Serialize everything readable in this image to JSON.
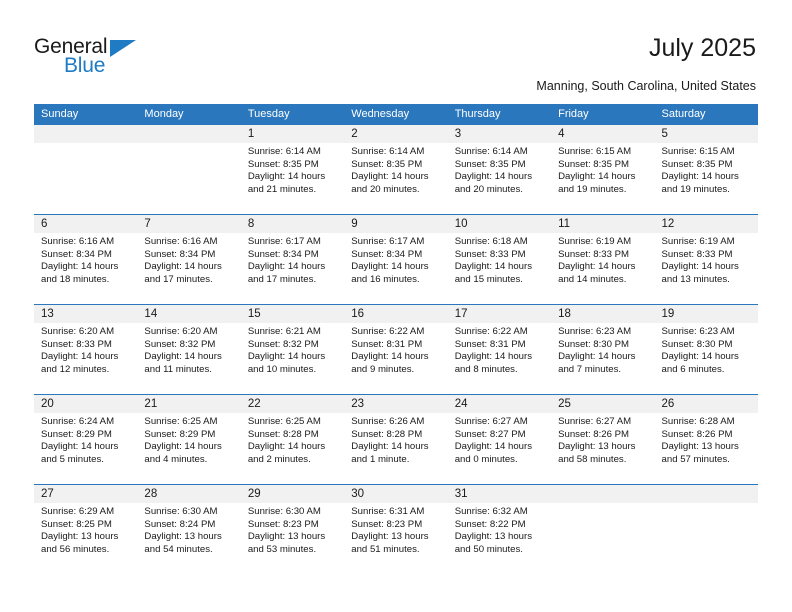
{
  "brand": {
    "name_top": "General",
    "name_bottom": "Blue",
    "accent_color": "#1e7bc4"
  },
  "header": {
    "title": "July 2025",
    "subtitle": "Manning, South Carolina, United States"
  },
  "theme": {
    "header_blue": "#2b77bd",
    "daynum_band": "#f1f1f1",
    "text": "#1a1a1a"
  },
  "weekdays": [
    "Sunday",
    "Monday",
    "Tuesday",
    "Wednesday",
    "Thursday",
    "Friday",
    "Saturday"
  ],
  "labels": {
    "sunrise_prefix": "Sunrise:",
    "sunset_prefix": "Sunset:",
    "daylight_prefix": "Daylight:"
  },
  "weeks": [
    [
      {
        "day": "",
        "empty": true
      },
      {
        "day": "",
        "empty": true
      },
      {
        "day": "1",
        "sunrise": "Sunrise: 6:14 AM",
        "sunset": "Sunset: 8:35 PM",
        "daylight": "Daylight: 14 hours and 21 minutes."
      },
      {
        "day": "2",
        "sunrise": "Sunrise: 6:14 AM",
        "sunset": "Sunset: 8:35 PM",
        "daylight": "Daylight: 14 hours and 20 minutes."
      },
      {
        "day": "3",
        "sunrise": "Sunrise: 6:14 AM",
        "sunset": "Sunset: 8:35 PM",
        "daylight": "Daylight: 14 hours and 20 minutes."
      },
      {
        "day": "4",
        "sunrise": "Sunrise: 6:15 AM",
        "sunset": "Sunset: 8:35 PM",
        "daylight": "Daylight: 14 hours and 19 minutes."
      },
      {
        "day": "5",
        "sunrise": "Sunrise: 6:15 AM",
        "sunset": "Sunset: 8:35 PM",
        "daylight": "Daylight: 14 hours and 19 minutes."
      }
    ],
    [
      {
        "day": "6",
        "sunrise": "Sunrise: 6:16 AM",
        "sunset": "Sunset: 8:34 PM",
        "daylight": "Daylight: 14 hours and 18 minutes."
      },
      {
        "day": "7",
        "sunrise": "Sunrise: 6:16 AM",
        "sunset": "Sunset: 8:34 PM",
        "daylight": "Daylight: 14 hours and 17 minutes."
      },
      {
        "day": "8",
        "sunrise": "Sunrise: 6:17 AM",
        "sunset": "Sunset: 8:34 PM",
        "daylight": "Daylight: 14 hours and 17 minutes."
      },
      {
        "day": "9",
        "sunrise": "Sunrise: 6:17 AM",
        "sunset": "Sunset: 8:34 PM",
        "daylight": "Daylight: 14 hours and 16 minutes."
      },
      {
        "day": "10",
        "sunrise": "Sunrise: 6:18 AM",
        "sunset": "Sunset: 8:33 PM",
        "daylight": "Daylight: 14 hours and 15 minutes."
      },
      {
        "day": "11",
        "sunrise": "Sunrise: 6:19 AM",
        "sunset": "Sunset: 8:33 PM",
        "daylight": "Daylight: 14 hours and 14 minutes."
      },
      {
        "day": "12",
        "sunrise": "Sunrise: 6:19 AM",
        "sunset": "Sunset: 8:33 PM",
        "daylight": "Daylight: 14 hours and 13 minutes."
      }
    ],
    [
      {
        "day": "13",
        "sunrise": "Sunrise: 6:20 AM",
        "sunset": "Sunset: 8:33 PM",
        "daylight": "Daylight: 14 hours and 12 minutes."
      },
      {
        "day": "14",
        "sunrise": "Sunrise: 6:20 AM",
        "sunset": "Sunset: 8:32 PM",
        "daylight": "Daylight: 14 hours and 11 minutes."
      },
      {
        "day": "15",
        "sunrise": "Sunrise: 6:21 AM",
        "sunset": "Sunset: 8:32 PM",
        "daylight": "Daylight: 14 hours and 10 minutes."
      },
      {
        "day": "16",
        "sunrise": "Sunrise: 6:22 AM",
        "sunset": "Sunset: 8:31 PM",
        "daylight": "Daylight: 14 hours and 9 minutes."
      },
      {
        "day": "17",
        "sunrise": "Sunrise: 6:22 AM",
        "sunset": "Sunset: 8:31 PM",
        "daylight": "Daylight: 14 hours and 8 minutes."
      },
      {
        "day": "18",
        "sunrise": "Sunrise: 6:23 AM",
        "sunset": "Sunset: 8:30 PM",
        "daylight": "Daylight: 14 hours and 7 minutes."
      },
      {
        "day": "19",
        "sunrise": "Sunrise: 6:23 AM",
        "sunset": "Sunset: 8:30 PM",
        "daylight": "Daylight: 14 hours and 6 minutes."
      }
    ],
    [
      {
        "day": "20",
        "sunrise": "Sunrise: 6:24 AM",
        "sunset": "Sunset: 8:29 PM",
        "daylight": "Daylight: 14 hours and 5 minutes."
      },
      {
        "day": "21",
        "sunrise": "Sunrise: 6:25 AM",
        "sunset": "Sunset: 8:29 PM",
        "daylight": "Daylight: 14 hours and 4 minutes."
      },
      {
        "day": "22",
        "sunrise": "Sunrise: 6:25 AM",
        "sunset": "Sunset: 8:28 PM",
        "daylight": "Daylight: 14 hours and 2 minutes."
      },
      {
        "day": "23",
        "sunrise": "Sunrise: 6:26 AM",
        "sunset": "Sunset: 8:28 PM",
        "daylight": "Daylight: 14 hours and 1 minute."
      },
      {
        "day": "24",
        "sunrise": "Sunrise: 6:27 AM",
        "sunset": "Sunset: 8:27 PM",
        "daylight": "Daylight: 14 hours and 0 minutes."
      },
      {
        "day": "25",
        "sunrise": "Sunrise: 6:27 AM",
        "sunset": "Sunset: 8:26 PM",
        "daylight": "Daylight: 13 hours and 58 minutes."
      },
      {
        "day": "26",
        "sunrise": "Sunrise: 6:28 AM",
        "sunset": "Sunset: 8:26 PM",
        "daylight": "Daylight: 13 hours and 57 minutes."
      }
    ],
    [
      {
        "day": "27",
        "sunrise": "Sunrise: 6:29 AM",
        "sunset": "Sunset: 8:25 PM",
        "daylight": "Daylight: 13 hours and 56 minutes."
      },
      {
        "day": "28",
        "sunrise": "Sunrise: 6:30 AM",
        "sunset": "Sunset: 8:24 PM",
        "daylight": "Daylight: 13 hours and 54 minutes."
      },
      {
        "day": "29",
        "sunrise": "Sunrise: 6:30 AM",
        "sunset": "Sunset: 8:23 PM",
        "daylight": "Daylight: 13 hours and 53 minutes."
      },
      {
        "day": "30",
        "sunrise": "Sunrise: 6:31 AM",
        "sunset": "Sunset: 8:23 PM",
        "daylight": "Daylight: 13 hours and 51 minutes."
      },
      {
        "day": "31",
        "sunrise": "Sunrise: 6:32 AM",
        "sunset": "Sunset: 8:22 PM",
        "daylight": "Daylight: 13 hours and 50 minutes."
      },
      {
        "day": "",
        "empty": true
      },
      {
        "day": "",
        "empty": true
      }
    ]
  ]
}
